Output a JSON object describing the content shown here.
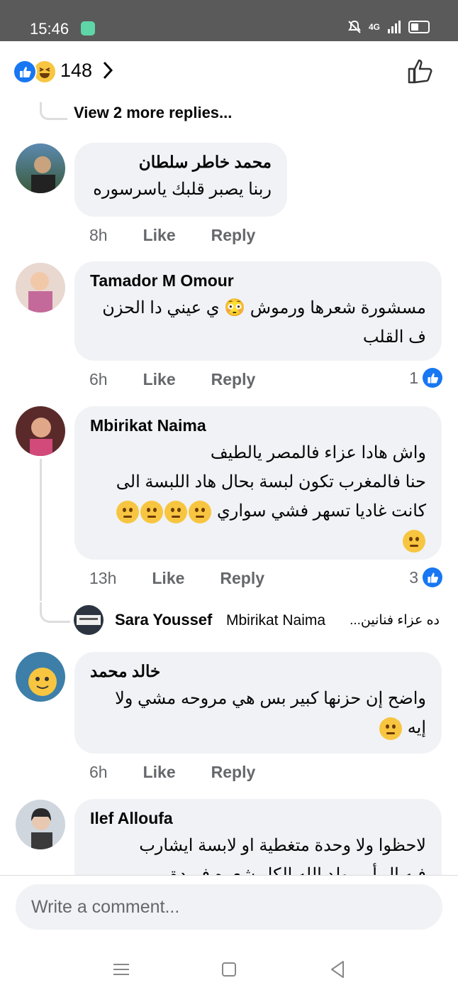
{
  "status_bar": {
    "time": "15:46",
    "network": "4G"
  },
  "reactions": {
    "count": "148",
    "icons": [
      "like-icon",
      "haha-icon"
    ]
  },
  "view_more_replies": "View 2 more replies...",
  "comments": [
    {
      "author": "محمد خاطر سلطان",
      "lines": [
        "ربنا يصبر قلبك ياسرسوره"
      ],
      "time": "8h",
      "like": "Like",
      "reply": "Reply"
    },
    {
      "author": "Tamador M Omour",
      "lines": [
        "مسشورة شعرها ورموش 😳 ي عيني دا الحزن",
        "ف القلب"
      ],
      "time": "6h",
      "like": "Like",
      "reply": "Reply",
      "likes": "1"
    },
    {
      "author": "Mbirikat Naima",
      "lines": [
        "واش هادا عزاء فالمصر  يالطيف",
        "حنا فالمغرب تكون لبسة بحال هاد اللبسة الى",
        "كانت غاديا تسهر فشي سواري"
      ],
      "time": "13h",
      "like": "Like",
      "reply": "Reply",
      "likes": "3"
    },
    {
      "author": "خالد محمد",
      "lines": [
        "واضح إن حزنها كبير بس هي مروحه مشي ولا",
        "إيه"
      ],
      "time": "6h",
      "like": "Like",
      "reply": "Reply"
    },
    {
      "author": "Ilef Alloufa",
      "lines": [
        "لاحظوا ولا وحدة  متغطية او لابسة ايشارب",
        "فيه ال أ ... ولد الله الكل شعره فريدة"
      ]
    }
  ],
  "nested_reply": {
    "author": "Sara Youssef",
    "tag": "Mbirikat Naima",
    "text": "ده عزاء فنانين..."
  },
  "composer": {
    "placeholder": "Write a comment..."
  },
  "colors": {
    "accent": "#1877f2",
    "bubble": "#f0f2f5",
    "muted": "#65676b"
  }
}
